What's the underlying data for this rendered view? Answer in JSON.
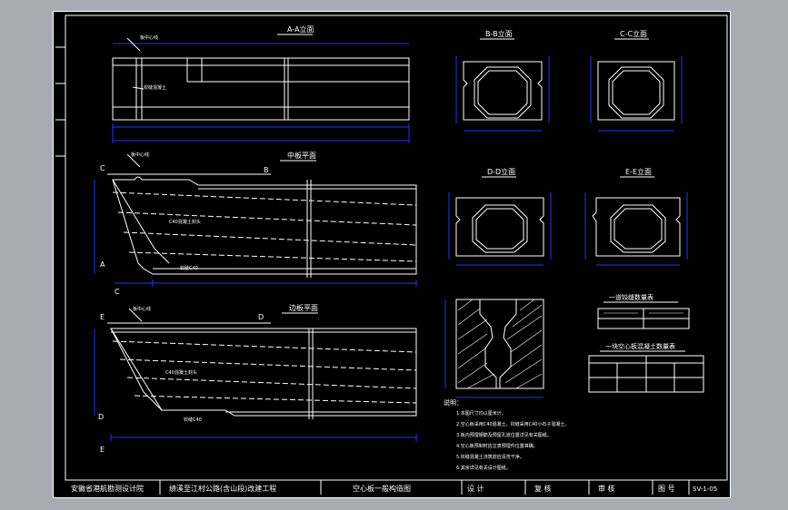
{
  "views": {
    "aa": {
      "title": "A-A立面",
      "label_center": "板中心线",
      "label_hinge": "铰缝混凝土"
    },
    "bb": {
      "title": "B-B立面"
    },
    "cc": {
      "title": "C-C立面"
    },
    "dd": {
      "title": "D-D立面"
    },
    "ee": {
      "title": "E-E立面"
    },
    "middle": {
      "title": "中板平面",
      "label_center": "板中心线",
      "label_rebar": "C40混凝土封头",
      "label_hinge": "铰缝C40"
    },
    "edge": {
      "title": "边板平面",
      "label_center": "板中心线",
      "label_rebar": "C40混凝土封头",
      "label_hinge": "铰缝C40"
    }
  },
  "section_marks": {
    "a": "A",
    "b": "B",
    "c": "C",
    "d": "D",
    "e": "E"
  },
  "tables": {
    "joint": {
      "title": "一道铰缝数量表"
    },
    "concrete": {
      "title": "一块空心板混凝土数量表"
    }
  },
  "notes": {
    "heading": "说明：",
    "items": [
      "1.本图尺寸均以厘米计。",
      "2.空心板采用C40混凝土，铰缝采用C40小石子混凝土。",
      "3.板内预埋钢筋及预留孔道位置详见有关图纸。",
      "4.空心板预制时应注意预埋件位置准确。",
      "5.铰缝混凝土浇筑前应清洗干净。",
      "6.其余详见有关设计图纸。"
    ]
  },
  "title_block": {
    "company": "安徽省港航勘测设计院",
    "project": "绩溪至江村公路(含山段)改建工程",
    "drawing": "空心板一般构造图",
    "design": "设 计",
    "review": "复 核",
    "approve": "审 核",
    "figure_label": "图 号",
    "figure_no": "SV-1-05"
  }
}
